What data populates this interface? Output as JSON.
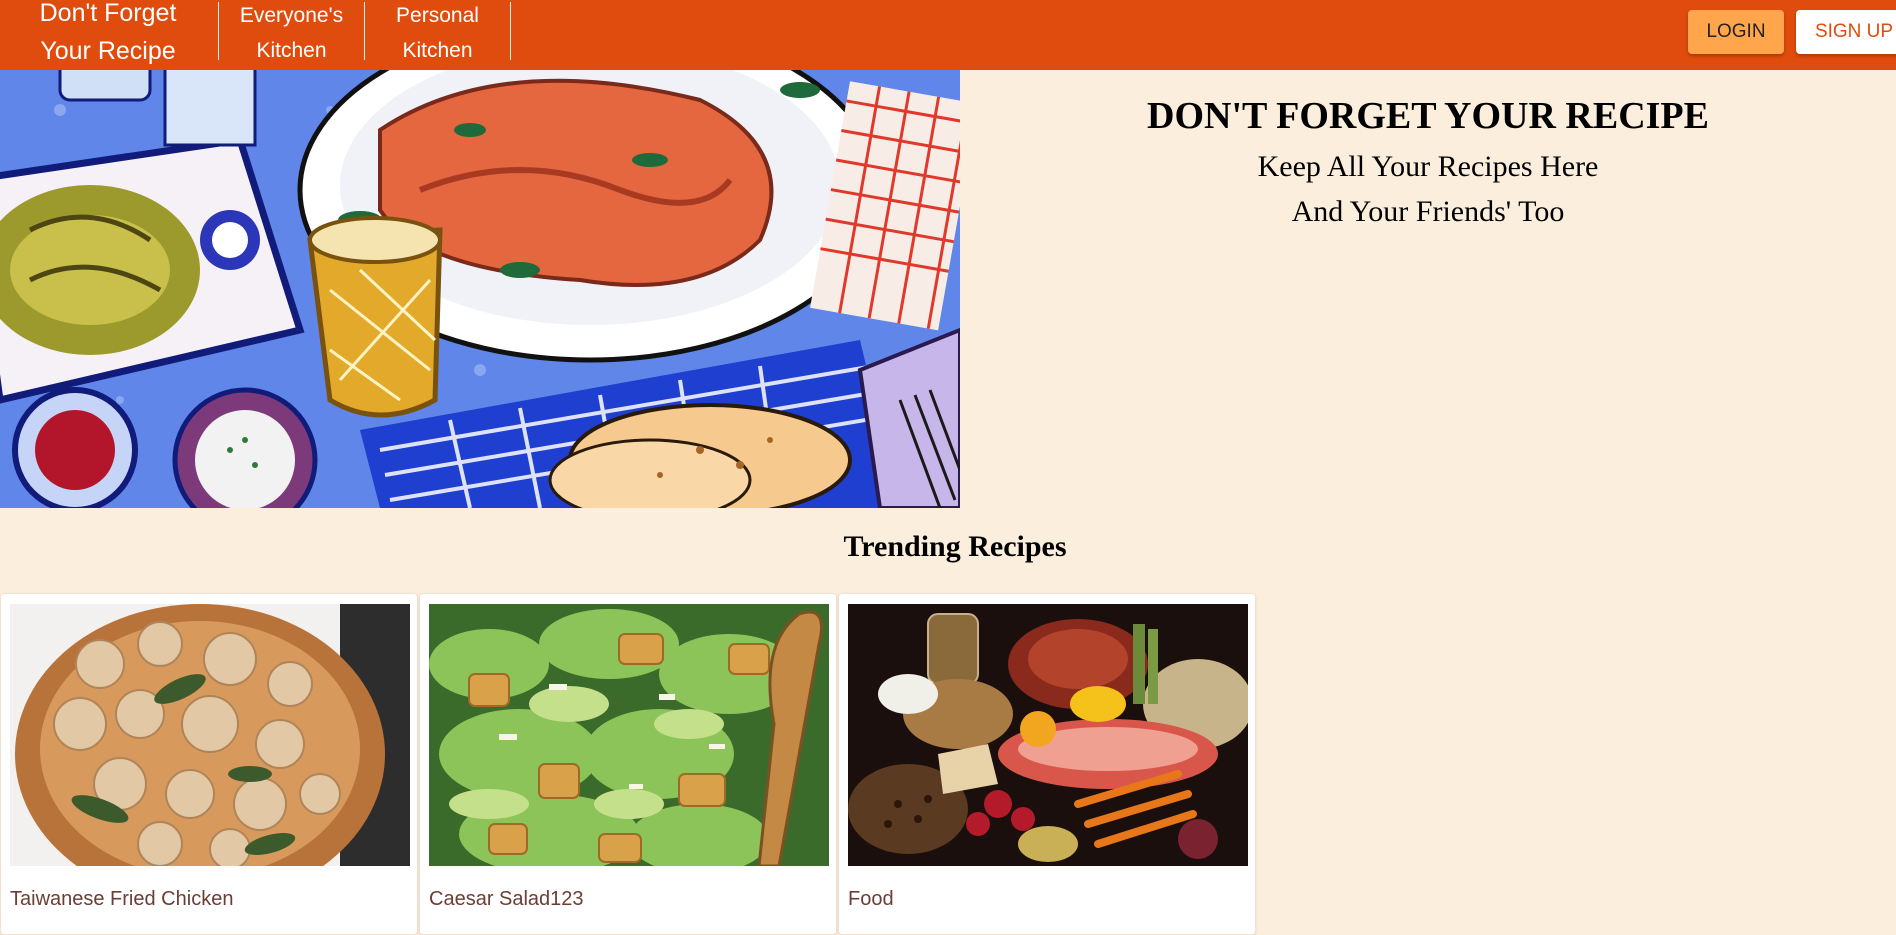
{
  "header": {
    "brand_line1": "Don't Forget",
    "brand_line2": "Your Recipe",
    "nav": [
      {
        "line1": "Everyone's",
        "line2": "Kitchen"
      },
      {
        "line1": "Personal",
        "line2": "Kitchen"
      }
    ],
    "login_label": "LOGIN",
    "signup_label": "SIGN UP",
    "colors": {
      "bar": "#e04c0e",
      "login_bg": "#ffa64d",
      "signup_text": "#e04c0e"
    }
  },
  "hero": {
    "title": "DON'T FORGET YOUR RECIPE",
    "subtitle_line1": "Keep All Your Recipes Here",
    "subtitle_line2": "And Your Friends' Too"
  },
  "trending": {
    "heading": "Trending Recipes",
    "recipes": [
      {
        "title": "Taiwanese Fried Chicken"
      },
      {
        "title": "Caesar Salad123"
      },
      {
        "title": "Food"
      }
    ]
  },
  "page": {
    "background": "#fbeedd"
  }
}
